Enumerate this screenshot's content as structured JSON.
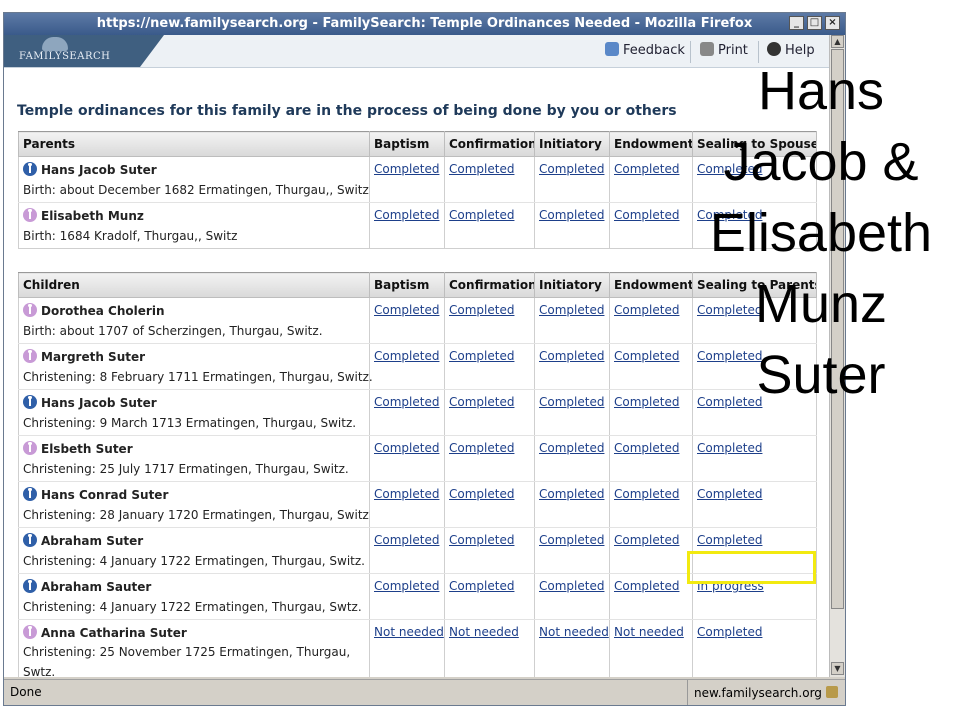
{
  "window": {
    "title": "https://new.familysearch.org - FamilySearch: Temple Ordinances Needed - Mozilla Firefox"
  },
  "header": {
    "logo_text": "FAMILYSEARCH",
    "feedback": "Feedback",
    "print": "Print",
    "help": "Help"
  },
  "page": {
    "heading": "Temple ordinances for this family are in the process of being done by you or others"
  },
  "parents_table": {
    "headers": [
      "Parents",
      "Baptism",
      "Confirmation",
      "Initiatory",
      "Endowment",
      "Sealing to Spouse"
    ],
    "rows": [
      {
        "gender": "male",
        "name": "Hans Jacob Suter",
        "event": "Birth: about December 1682 Ermatingen, Thurgau,, Switz",
        "ords": [
          "Completed",
          "Completed",
          "Completed",
          "Completed",
          "Completed"
        ]
      },
      {
        "gender": "female",
        "name": "Elisabeth Munz",
        "event": "Birth: 1684 Kradolf, Thurgau,, Switz",
        "ords": [
          "Completed",
          "Completed",
          "Completed",
          "Completed",
          "Completed"
        ]
      }
    ]
  },
  "children_table": {
    "headers": [
      "Children",
      "Baptism",
      "Confirmation",
      "Initiatory",
      "Endowment",
      "Sealing to Parents"
    ],
    "rows": [
      {
        "gender": "female",
        "name": "Dorothea Cholerin",
        "event": "Birth: about 1707 of Scherzingen, Thurgau, Switz.",
        "ords": [
          "Completed",
          "Completed",
          "Completed",
          "Completed",
          "Completed"
        ]
      },
      {
        "gender": "female",
        "name": "Margreth Suter",
        "event": "Christening: 8 February 1711 Ermatingen, Thurgau, Switz.",
        "ords": [
          "Completed",
          "Completed",
          "Completed",
          "Completed",
          "Completed"
        ]
      },
      {
        "gender": "male",
        "name": "Hans Jacob Suter",
        "event": "Christening: 9 March 1713 Ermatingen, Thurgau, Switz.",
        "ords": [
          "Completed",
          "Completed",
          "Completed",
          "Completed",
          "Completed"
        ]
      },
      {
        "gender": "female",
        "name": "Elsbeth Suter",
        "event": "Christening: 25 July 1717 Ermatingen, Thurgau, Switz.",
        "ords": [
          "Completed",
          "Completed",
          "Completed",
          "Completed",
          "Completed"
        ]
      },
      {
        "gender": "male",
        "name": "Hans Conrad Suter",
        "event": "Christening: 28 January 1720 Ermatingen, Thurgau, Switz",
        "ords": [
          "Completed",
          "Completed",
          "Completed",
          "Completed",
          "Completed"
        ]
      },
      {
        "gender": "male",
        "name": "Abraham Suter",
        "event": "Christening: 4 January 1722 Ermatingen, Thurgau, Switz.",
        "ords": [
          "Completed",
          "Completed",
          "Completed",
          "Completed",
          "Completed"
        ]
      },
      {
        "gender": "male",
        "name": "Abraham Sauter",
        "event": "Christening: 4 January 1722 Ermatingen, Thurgau, Swtz.",
        "ords": [
          "Completed",
          "Completed",
          "Completed",
          "Completed",
          "In progress"
        ]
      },
      {
        "gender": "female",
        "name": "Anna Catharina Suter",
        "event": "Christening: 25 November 1725 Ermatingen, Thurgau, Swtz.",
        "ords": [
          "Not needed",
          "Not needed",
          "Not needed",
          "Not needed",
          "Completed"
        ]
      }
    ]
  },
  "status": {
    "left": "Done",
    "right": "new.familysearch.org"
  },
  "overlay": {
    "lines": [
      "Hans",
      "Jacob &",
      "Elisabeth",
      "Munz",
      "Suter"
    ]
  },
  "colors": {
    "titlebar": "#3a5a8a",
    "link": "#1d3f8a",
    "highlight": "#f2ea10",
    "male": "#2f5fa8",
    "female": "#c89ad6"
  }
}
